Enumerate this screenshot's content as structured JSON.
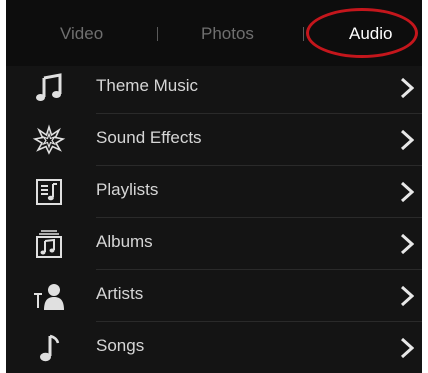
{
  "tabs": [
    {
      "label": "Video",
      "selected": false
    },
    {
      "label": "Photos",
      "selected": false
    },
    {
      "label": "Audio",
      "selected": true
    }
  ],
  "list": {
    "items": [
      {
        "label": "Theme Music",
        "icon": "music-note-icon"
      },
      {
        "label": "Sound Effects",
        "icon": "starburst-icon"
      },
      {
        "label": "Playlists",
        "icon": "playlist-icon"
      },
      {
        "label": "Albums",
        "icon": "album-icon"
      },
      {
        "label": "Artists",
        "icon": "artist-icon"
      },
      {
        "label": "Songs",
        "icon": "single-note-icon"
      }
    ]
  },
  "colors": {
    "background": "#141414",
    "tabbar": "#0d0d0d",
    "highlight": "#c4161c",
    "text": "#d6d6d6",
    "inactive_tab": "#6f6f6f"
  }
}
